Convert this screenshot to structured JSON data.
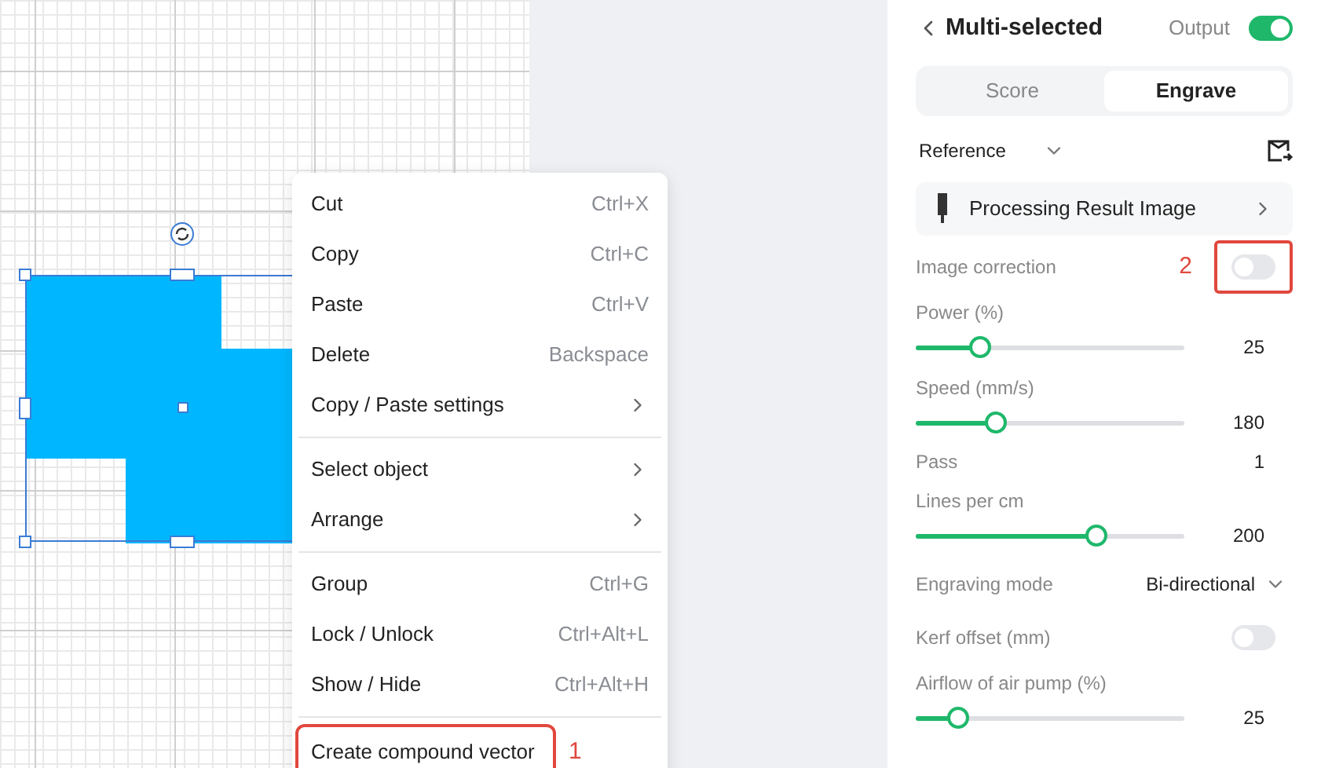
{
  "context_menu": {
    "sections": [
      [
        {
          "label": "Cut",
          "shortcut": "Ctrl+X",
          "kind": "shortcut"
        },
        {
          "label": "Copy",
          "shortcut": "Ctrl+C",
          "kind": "shortcut"
        },
        {
          "label": "Paste",
          "shortcut": "Ctrl+V",
          "kind": "shortcut"
        },
        {
          "label": "Delete",
          "shortcut": "Backspace",
          "kind": "shortcut"
        },
        {
          "label": "Copy / Paste settings",
          "kind": "submenu"
        }
      ],
      [
        {
          "label": "Select object",
          "kind": "submenu"
        },
        {
          "label": "Arrange",
          "kind": "submenu"
        }
      ],
      [
        {
          "label": "Group",
          "shortcut": "Ctrl+G",
          "kind": "shortcut"
        },
        {
          "label": "Lock / Unlock",
          "shortcut": "Ctrl+Alt+L",
          "kind": "shortcut"
        },
        {
          "label": "Show / Hide",
          "shortcut": "Ctrl+Alt+H",
          "kind": "shortcut"
        }
      ],
      [
        {
          "label": "Create compound vector",
          "kind": "plain",
          "highlighted": true,
          "marker": "1"
        }
      ]
    ]
  },
  "panel": {
    "title": "Multi-selected",
    "output": {
      "label": "Output",
      "on": true
    },
    "tabs": [
      {
        "label": "Score",
        "selected": false
      },
      {
        "label": "Engrave",
        "selected": true
      }
    ],
    "reference": {
      "label": "Reference"
    },
    "processing": {
      "label": "Processing Result Image"
    },
    "settings": [
      {
        "kind": "toggle",
        "label": "Image correction",
        "on": false,
        "highlighted": true,
        "marker": "2"
      },
      {
        "kind": "slider",
        "label": "Power (%)",
        "level": 0.24,
        "value": "25"
      },
      {
        "kind": "slider",
        "label": "Speed (mm/s)",
        "level": 0.3,
        "value": "180"
      },
      {
        "kind": "value",
        "label": "Pass",
        "value": "1"
      },
      {
        "kind": "slider",
        "label": "Lines per cm",
        "level": 0.67,
        "value": "200"
      },
      {
        "kind": "select",
        "label": "Engraving mode",
        "value": "Bi-directional"
      },
      {
        "kind": "toggle",
        "label": "Kerf offset (mm)",
        "on": false,
        "highlighted": false
      },
      {
        "kind": "slider",
        "label": "Airflow of air pump (%)",
        "level": 0.16,
        "value": "25"
      }
    ]
  }
}
